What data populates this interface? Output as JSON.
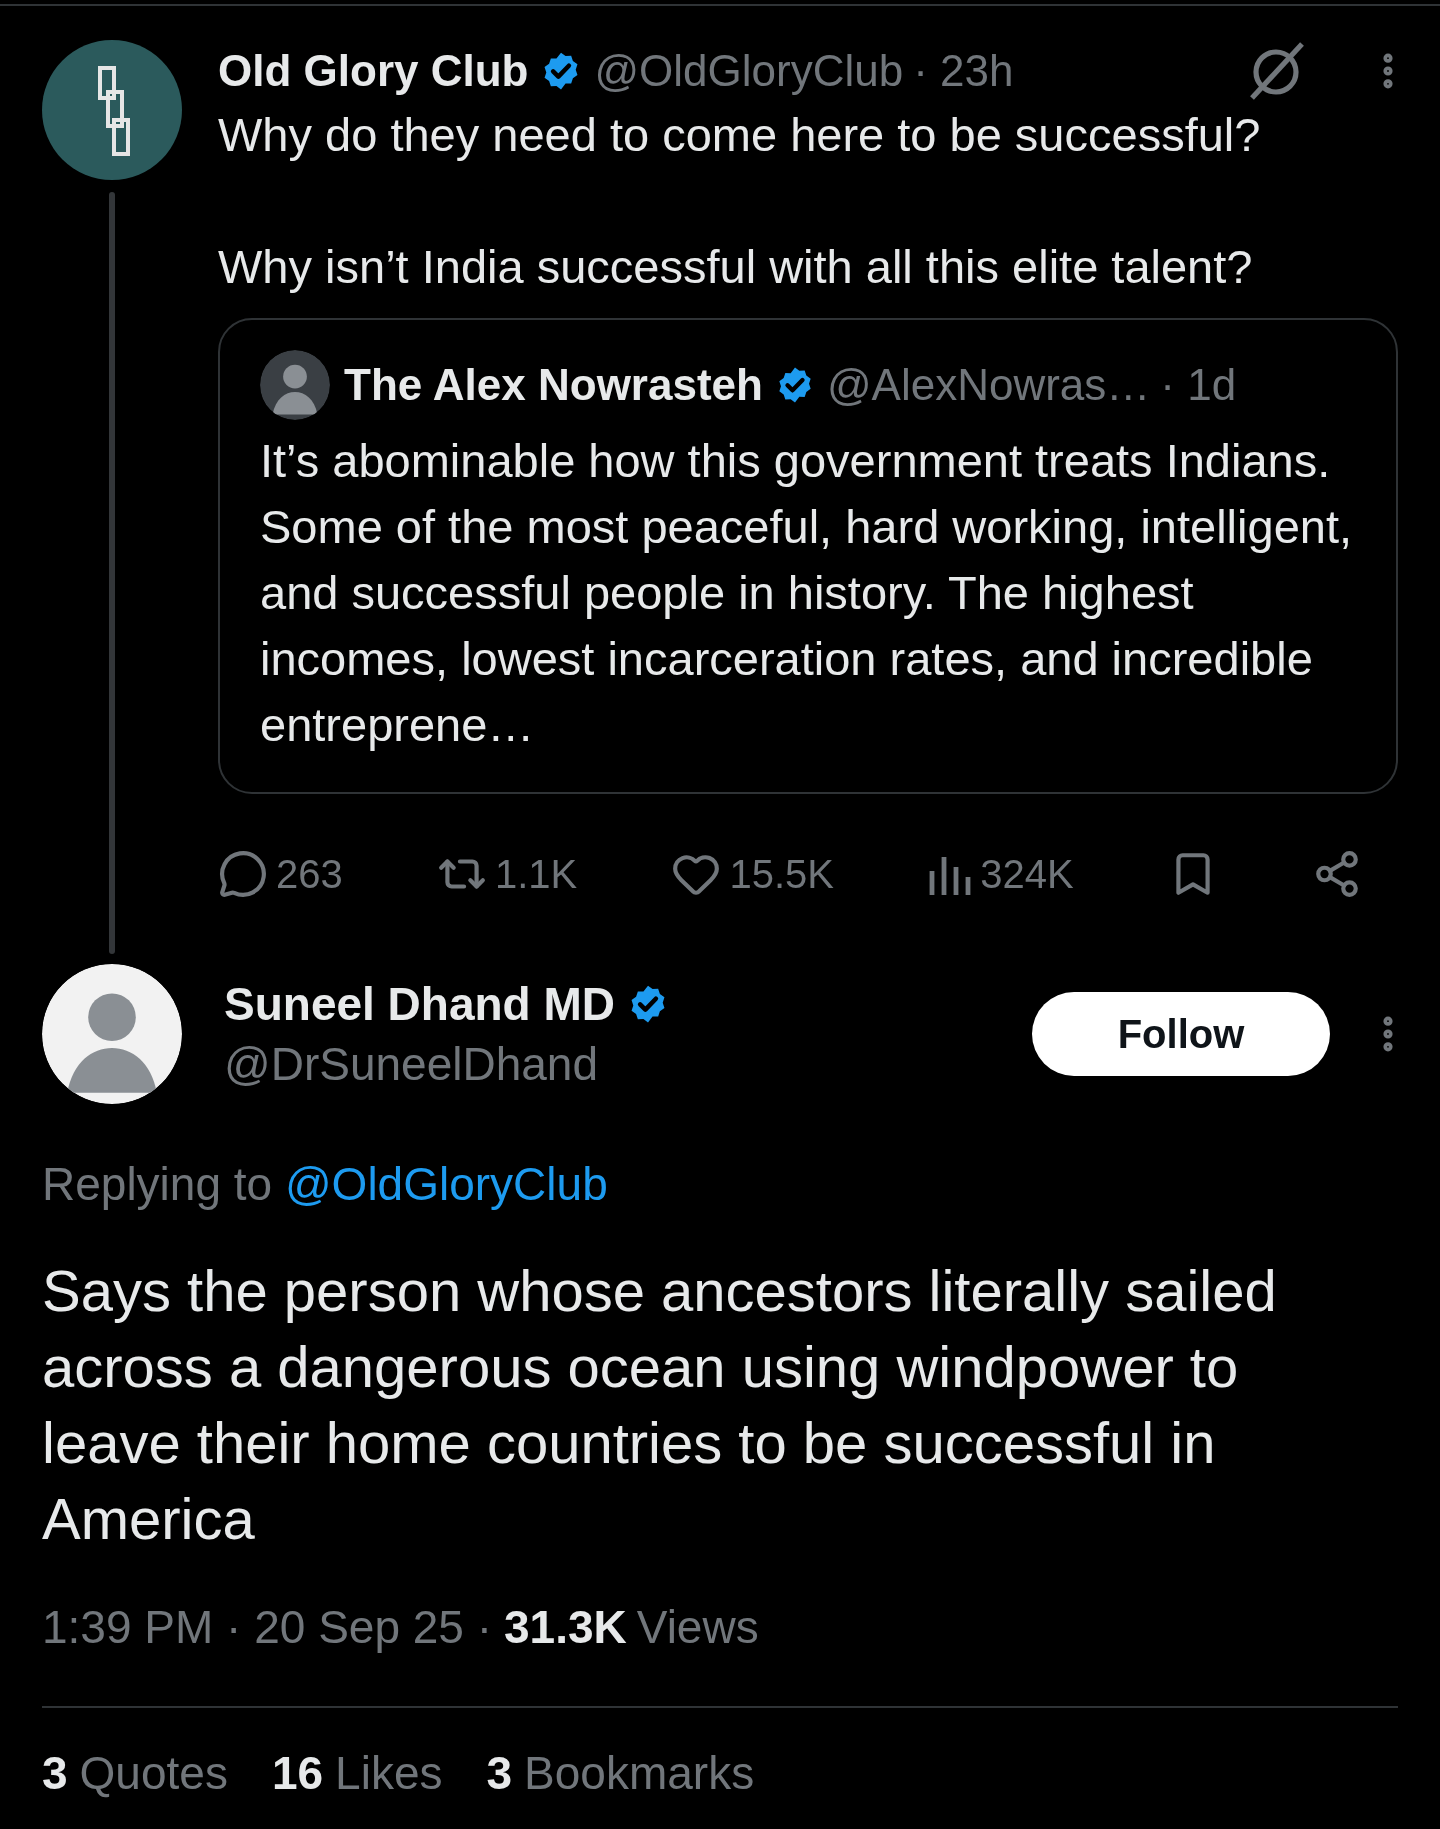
{
  "parent_post": {
    "author": {
      "name": "Old Glory Club",
      "handle": "@OldGloryClub",
      "verified": true
    },
    "time": "· 23h",
    "text": [
      "Why do they need to come here to be successful?",
      "Why isn’t India successful with all this elite talent?"
    ],
    "quoted_post": {
      "author": {
        "name": "The Alex Nowrasteh",
        "handle": "@AlexNowras…",
        "verified": true
      },
      "time": "· 1d",
      "text": "It’s abominable how this government treats Indians. Some of the most peaceful, hard working, intelligent, and successful people in history. The highest incomes, lowest incarceration rates, and incredible entreprene…"
    },
    "actions": [
      {
        "kind": "reply",
        "count": "263"
      },
      {
        "kind": "repost",
        "count": "1.1K"
      },
      {
        "kind": "like",
        "count": "15.5K"
      },
      {
        "kind": "views",
        "count": "324K"
      },
      {
        "kind": "bookmark"
      },
      {
        "kind": "share"
      }
    ]
  },
  "reply": {
    "author": {
      "name": "Suneel Dhand MD",
      "handle": "@DrSuneelDhand",
      "verified": true
    },
    "follow_button": "Follow",
    "replying_label": "Replying to",
    "replying_handle": "@OldGloryClub",
    "text": "Says the person whose ancestors literally sailed across a dangerous ocean using windpower to leave their home countries to be successful in America",
    "timestamp": "1:39 PM · 20 Sep 25 ·",
    "views_count": "31.3K",
    "views_label": "Views",
    "stats": [
      {
        "count": "3",
        "label": "Quotes"
      },
      {
        "count": "16",
        "label": "Likes"
      },
      {
        "count": "3",
        "label": "Bookmarks"
      }
    ]
  }
}
